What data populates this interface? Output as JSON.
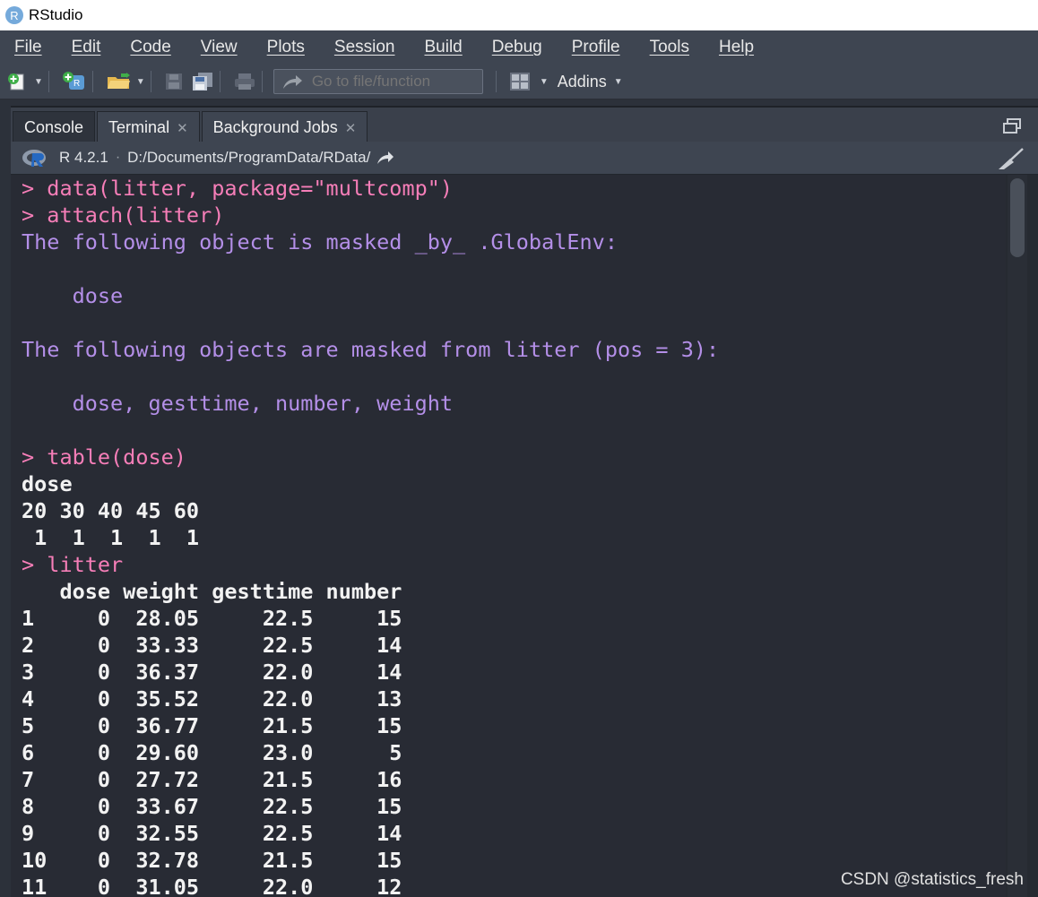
{
  "window": {
    "title": "RStudio",
    "logo_letter": "R"
  },
  "menu": [
    "File",
    "Edit",
    "Code",
    "View",
    "Plots",
    "Session",
    "Build",
    "Debug",
    "Profile",
    "Tools",
    "Help"
  ],
  "toolbar": {
    "goto_placeholder": "Go to file/function",
    "addins_label": "Addins"
  },
  "tabs": [
    {
      "label": "Console",
      "active": true,
      "closable": false
    },
    {
      "label": "Terminal",
      "active": false,
      "closable": true
    },
    {
      "label": "Background Jobs",
      "active": false,
      "closable": true
    }
  ],
  "info": {
    "r_version": "R 4.2.1",
    "separator": "·",
    "working_dir": "D:/Documents/ProgramData/RData/"
  },
  "console": {
    "lines": [
      {
        "kind": "prompt",
        "text": "> data(litter, package=\"multcomp\")"
      },
      {
        "kind": "prompt",
        "text": "> attach(litter)"
      },
      {
        "kind": "msg",
        "text": "The following object is masked _by_ .GlobalEnv:"
      },
      {
        "kind": "msg",
        "text": ""
      },
      {
        "kind": "msg",
        "text": "    dose"
      },
      {
        "kind": "msg",
        "text": ""
      },
      {
        "kind": "msg",
        "text": "The following objects are masked from litter (pos = 3):"
      },
      {
        "kind": "msg",
        "text": ""
      },
      {
        "kind": "msg",
        "text": "    dose, gesttime, number, weight"
      },
      {
        "kind": "msg",
        "text": ""
      },
      {
        "kind": "prompt",
        "text": "> table(dose)"
      },
      {
        "kind": "out",
        "text": "dose"
      },
      {
        "kind": "out",
        "text": "20 30 40 45 60"
      },
      {
        "kind": "out",
        "text": " 1  1  1  1  1"
      },
      {
        "kind": "prompt",
        "text": "> litter"
      },
      {
        "kind": "out",
        "text": "   dose weight gesttime number"
      },
      {
        "kind": "out",
        "text": "1     0  28.05     22.5     15"
      },
      {
        "kind": "out",
        "text": "2     0  33.33     22.5     14"
      },
      {
        "kind": "out",
        "text": "3     0  36.37     22.0     14"
      },
      {
        "kind": "out",
        "text": "4     0  35.52     22.0     13"
      },
      {
        "kind": "out",
        "text": "5     0  36.77     21.5     15"
      },
      {
        "kind": "out",
        "text": "6     0  29.60     23.0      5"
      },
      {
        "kind": "out",
        "text": "7     0  27.72     21.5     16"
      },
      {
        "kind": "out",
        "text": "8     0  33.67     22.5     15"
      },
      {
        "kind": "out",
        "text": "9     0  32.55     22.5     14"
      },
      {
        "kind": "out",
        "text": "10    0  32.78     21.5     15"
      },
      {
        "kind": "out",
        "text": "11    0  31.05     22.0     12"
      }
    ]
  },
  "watermark": "CSDN @statistics_fresh",
  "colors": {
    "prompt": "#f67eb8",
    "message": "#b48fe8",
    "output": "#f2f2f2",
    "console_bg": "#282b34"
  }
}
